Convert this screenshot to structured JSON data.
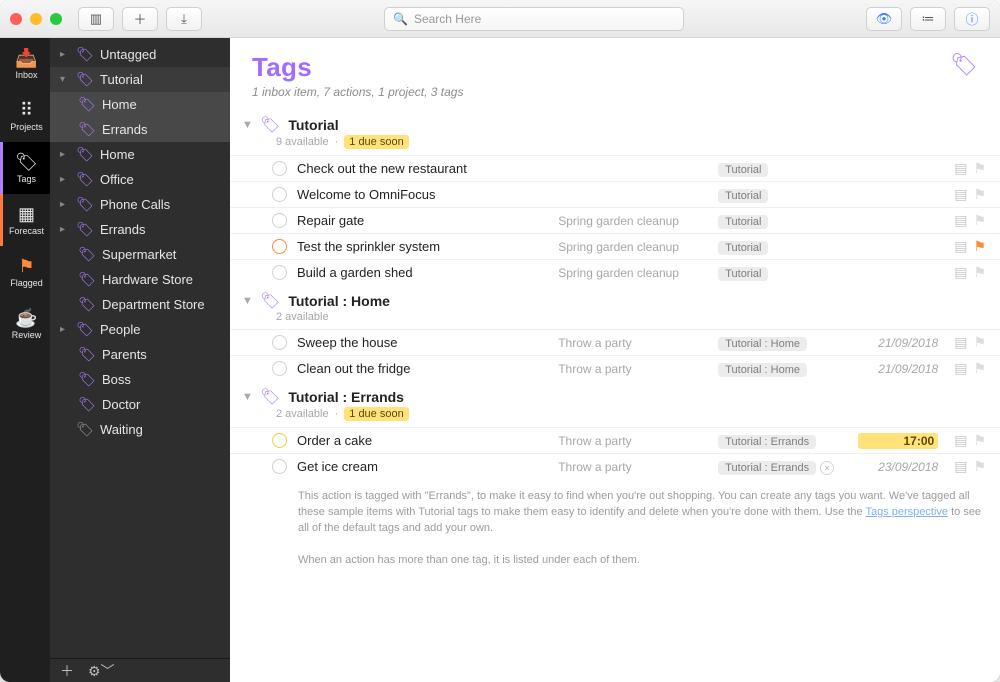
{
  "search": {
    "placeholder": "Search Here"
  },
  "rail": [
    {
      "id": "inbox",
      "label": "Inbox",
      "icon": "📥"
    },
    {
      "id": "projects",
      "label": "Projects",
      "icon": "⠿"
    },
    {
      "id": "tags",
      "label": "Tags",
      "icon": "🏷"
    },
    {
      "id": "forecast",
      "label": "Forecast",
      "icon": "▦"
    },
    {
      "id": "flagged",
      "label": "Flagged",
      "icon": "⚑"
    },
    {
      "id": "review",
      "label": "Review",
      "icon": "☕"
    }
  ],
  "sidebar": {
    "items": [
      {
        "label": "Untagged",
        "kind": "arrow"
      },
      {
        "label": "Tutorial",
        "kind": "arrow",
        "selected": true,
        "children": [
          {
            "label": "Home"
          },
          {
            "label": "Errands"
          }
        ]
      },
      {
        "label": "Home",
        "kind": "arrow"
      },
      {
        "label": "Office",
        "kind": "arrow"
      },
      {
        "label": "Phone Calls",
        "kind": "arrow"
      },
      {
        "label": "Errands",
        "kind": "arrow",
        "children": [
          {
            "label": "Supermarket"
          },
          {
            "label": "Hardware Store"
          },
          {
            "label": "Department Store"
          }
        ]
      },
      {
        "label": "People",
        "kind": "arrow",
        "children": [
          {
            "label": "Parents"
          },
          {
            "label": "Boss"
          },
          {
            "label": "Doctor"
          }
        ]
      },
      {
        "label": "Waiting",
        "kind": "grey"
      }
    ]
  },
  "header": {
    "title": "Tags",
    "subtitle": "1 inbox item, 7 actions, 1 project, 3 tags"
  },
  "sections": [
    {
      "title": "Tutorial",
      "sub_available": "9 available",
      "due_chip": "1 due soon",
      "tasks": [
        {
          "title": "Check out the new restaurant",
          "project": "",
          "tag": "Tutorial",
          "date": "",
          "note": true,
          "flag": false,
          "circle": "grey"
        },
        {
          "title": "Welcome to OmniFocus",
          "project": "",
          "tag": "Tutorial",
          "date": "",
          "note": true,
          "flag": false,
          "circle": "grey"
        },
        {
          "title": "Repair gate",
          "project": "Spring garden cleanup",
          "tag": "Tutorial",
          "date": "",
          "note": true,
          "flag": false,
          "circle": "grey"
        },
        {
          "title": "Test the sprinkler system",
          "project": "Spring garden cleanup",
          "tag": "Tutorial",
          "date": "",
          "note": true,
          "flag": true,
          "circle": "orange"
        },
        {
          "title": "Build a garden shed",
          "project": "Spring garden cleanup",
          "tag": "Tutorial",
          "date": "",
          "note": true,
          "flag": false,
          "circle": "grey"
        }
      ]
    },
    {
      "title": "Tutorial : Home",
      "sub_available": "2 available",
      "due_chip": "",
      "tasks": [
        {
          "title": "Sweep the house",
          "project": "Throw a party",
          "tag": "Tutorial : Home",
          "date": "21/09/2018",
          "note": true,
          "flag": false,
          "circle": "grey"
        },
        {
          "title": "Clean out the fridge",
          "project": "Throw a party",
          "tag": "Tutorial : Home",
          "date": "21/09/2018",
          "note": true,
          "flag": false,
          "circle": "grey"
        }
      ]
    },
    {
      "title": "Tutorial : Errands",
      "sub_available": "2 available",
      "due_chip": "1 due soon",
      "tasks": [
        {
          "title": "Order a cake",
          "project": "Throw a party",
          "tag": "Tutorial : Errands",
          "date": "17:00",
          "due": true,
          "note": true,
          "flag": false,
          "circle": "yellow"
        },
        {
          "title": "Get ice cream",
          "project": "Throw a party",
          "tag": "Tutorial : Errands",
          "pill_x": true,
          "date": "23/09/2018",
          "note": true,
          "flag": false,
          "circle": "grey",
          "expanded_note": {
            "p1": "This action is tagged with \"Errands\", to make it easy to find when you're out shopping. You can create any tags you want. We've tagged all these sample items with Tutorial tags to make them easy to identify and delete when you're done with them. Use the ",
            "link": "Tags perspective",
            "p1b": " to see all of the default tags and add your own.",
            "p2": "When an action has more than one tag, it is listed under each of them."
          }
        }
      ]
    }
  ]
}
